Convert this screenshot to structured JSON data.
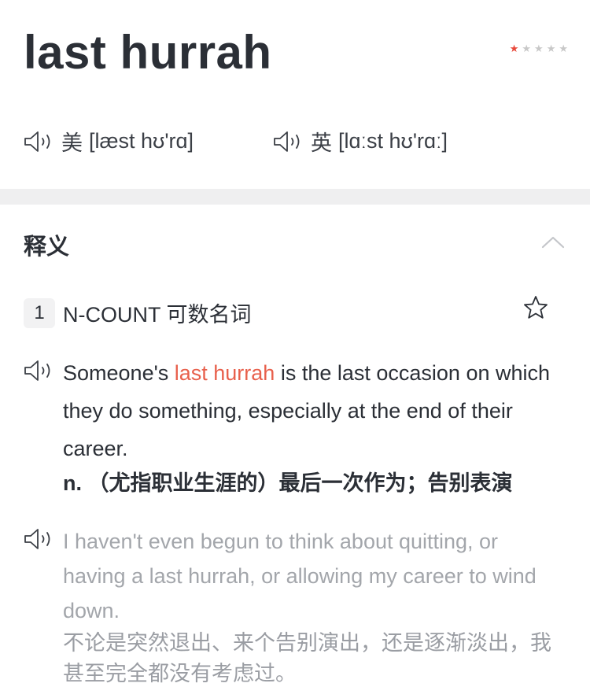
{
  "entry": {
    "headword": "last hurrah",
    "stars": {
      "filled": 1,
      "total": 5
    },
    "colors": {
      "accent": "#e8483a",
      "highlight": "#e8604c",
      "text": "#2b2f36",
      "muted": "#a3a6ab"
    }
  },
  "pronunciations": [
    {
      "region": "美",
      "ipa": "[læst hʊ'rɑ]",
      "icon": "speaker-icon"
    },
    {
      "region": "英",
      "ipa": "[lɑːst hʊ'rɑː]",
      "icon": "speaker-icon"
    }
  ],
  "definitions_section": {
    "title": "释义",
    "toggle_icon": "chevron-up-icon"
  },
  "sense": {
    "number": "1",
    "pos": "N-COUNT 可数名词",
    "fav_icon": "star-outline-icon",
    "definition": {
      "pre": "Someone's ",
      "highlight": "last hurrah",
      "post": " is the last occasion on which they do something, especially at the end of their career.",
      "translation": "n. （尤指职业生涯的）最后一次作为；告别表演"
    },
    "example": {
      "text": "I haven't  even begun to think about quitting, or having a last hurrah, or allowing my career to wind down.",
      "translation": "不论是突然退出、来个告别演出，还是逐渐淡出，我甚至完全都没有考虑过。"
    }
  }
}
